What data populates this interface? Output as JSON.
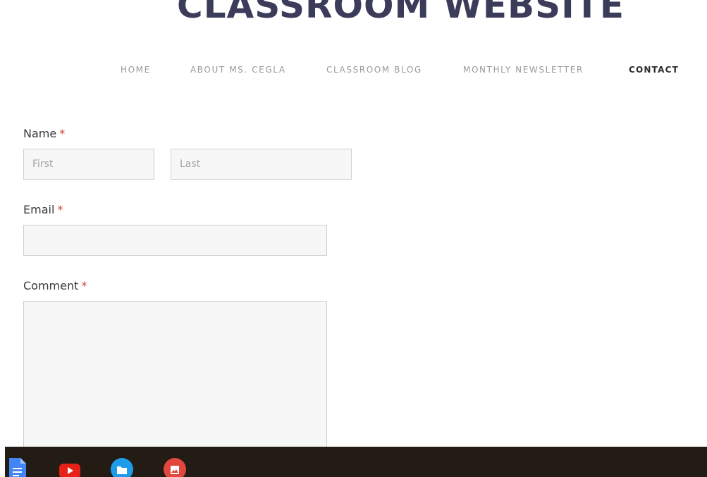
{
  "site": {
    "title": "CLASSROOM WEBSITE"
  },
  "nav": {
    "items": [
      {
        "label": "HOME",
        "active": false
      },
      {
        "label": "ABOUT MS. CEGLA",
        "active": false
      },
      {
        "label": "CLASSROOM BLOG",
        "active": false
      },
      {
        "label": "MONTHLY NEWSLETTER",
        "active": false
      },
      {
        "label": "CONTACT",
        "active": true
      }
    ]
  },
  "form": {
    "required_marker": "*",
    "name": {
      "label": "Name",
      "first_placeholder": "First",
      "last_placeholder": "Last",
      "first_value": "",
      "last_value": ""
    },
    "email": {
      "label": "Email",
      "value": ""
    },
    "comment": {
      "label": "Comment",
      "value": ""
    }
  },
  "shelf": {
    "apps": [
      {
        "name": "docs-icon",
        "color": "#4285f4"
      },
      {
        "name": "youtube-icon",
        "color": "#e62117"
      },
      {
        "name": "files-icon",
        "color": "#1e9be9"
      },
      {
        "name": "gallery-icon",
        "color": "#e2463d"
      }
    ]
  },
  "colors": {
    "title": "#3b3b5a",
    "nav_inactive": "#9a9a9a",
    "nav_active": "#2b2b2b",
    "required": "#d0413a",
    "shelf_bg": "#221c14"
  }
}
